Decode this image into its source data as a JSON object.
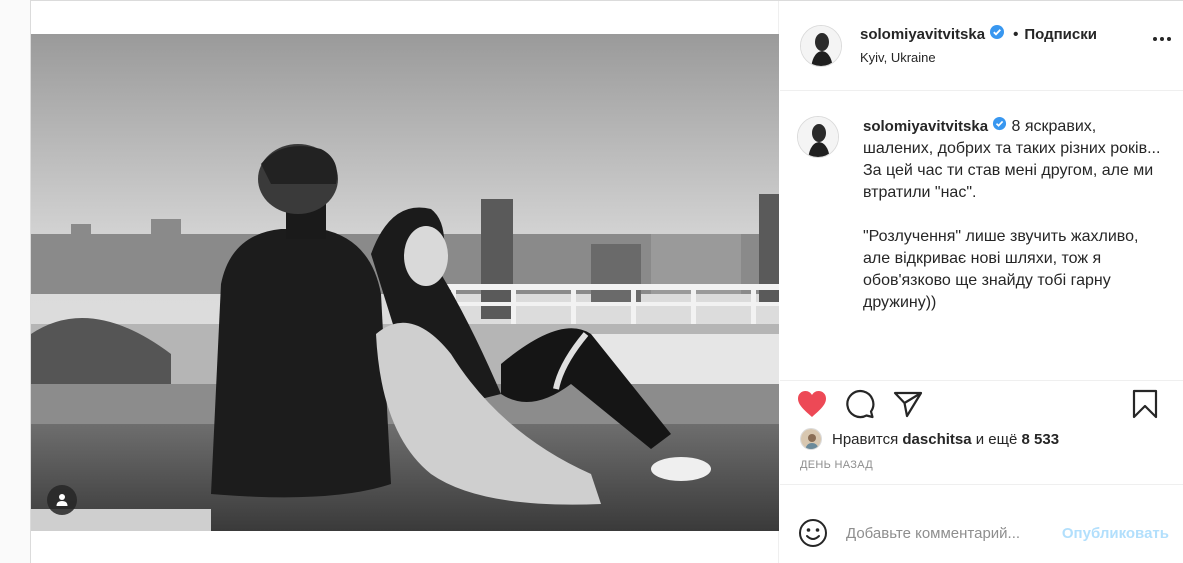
{
  "post": {
    "username": "solomiyavitvitska",
    "follow_label": "Подписки",
    "separator": "•",
    "location": "Kyiv, Ukraine"
  },
  "caption": {
    "username": "solomiyavitvitska",
    "text": "8 яскравих, шалених, добрих та таких різних років...\nЗа цей час ти став мені другом, але ми втратили \"нас\".\n\n\"Розлучення\" лише звучить жахливо, але відкриває нові шляхи, тож я обов'язково ще знайду тобі гарну дружину))"
  },
  "likes": {
    "prefix": "Нравится",
    "user": "daschitsa",
    "middle": "и ещё",
    "count": "8 533"
  },
  "date": "ДЕНЬ НАЗАД",
  "comment": {
    "placeholder": "Добавьте комментарий...",
    "publish_label": "Опубликовать"
  },
  "colors": {
    "like_red": "#ed4956",
    "publish_blue": "#b2dffc",
    "verified_blue": "#3897f0"
  },
  "icons": {
    "like": "heart-icon",
    "comment": "comment-icon",
    "share": "share-icon",
    "save": "bookmark-icon",
    "tag": "user-tag-icon",
    "emoji": "emoji-icon",
    "more": "more-options-icon",
    "verified": "verified-badge-icon"
  }
}
